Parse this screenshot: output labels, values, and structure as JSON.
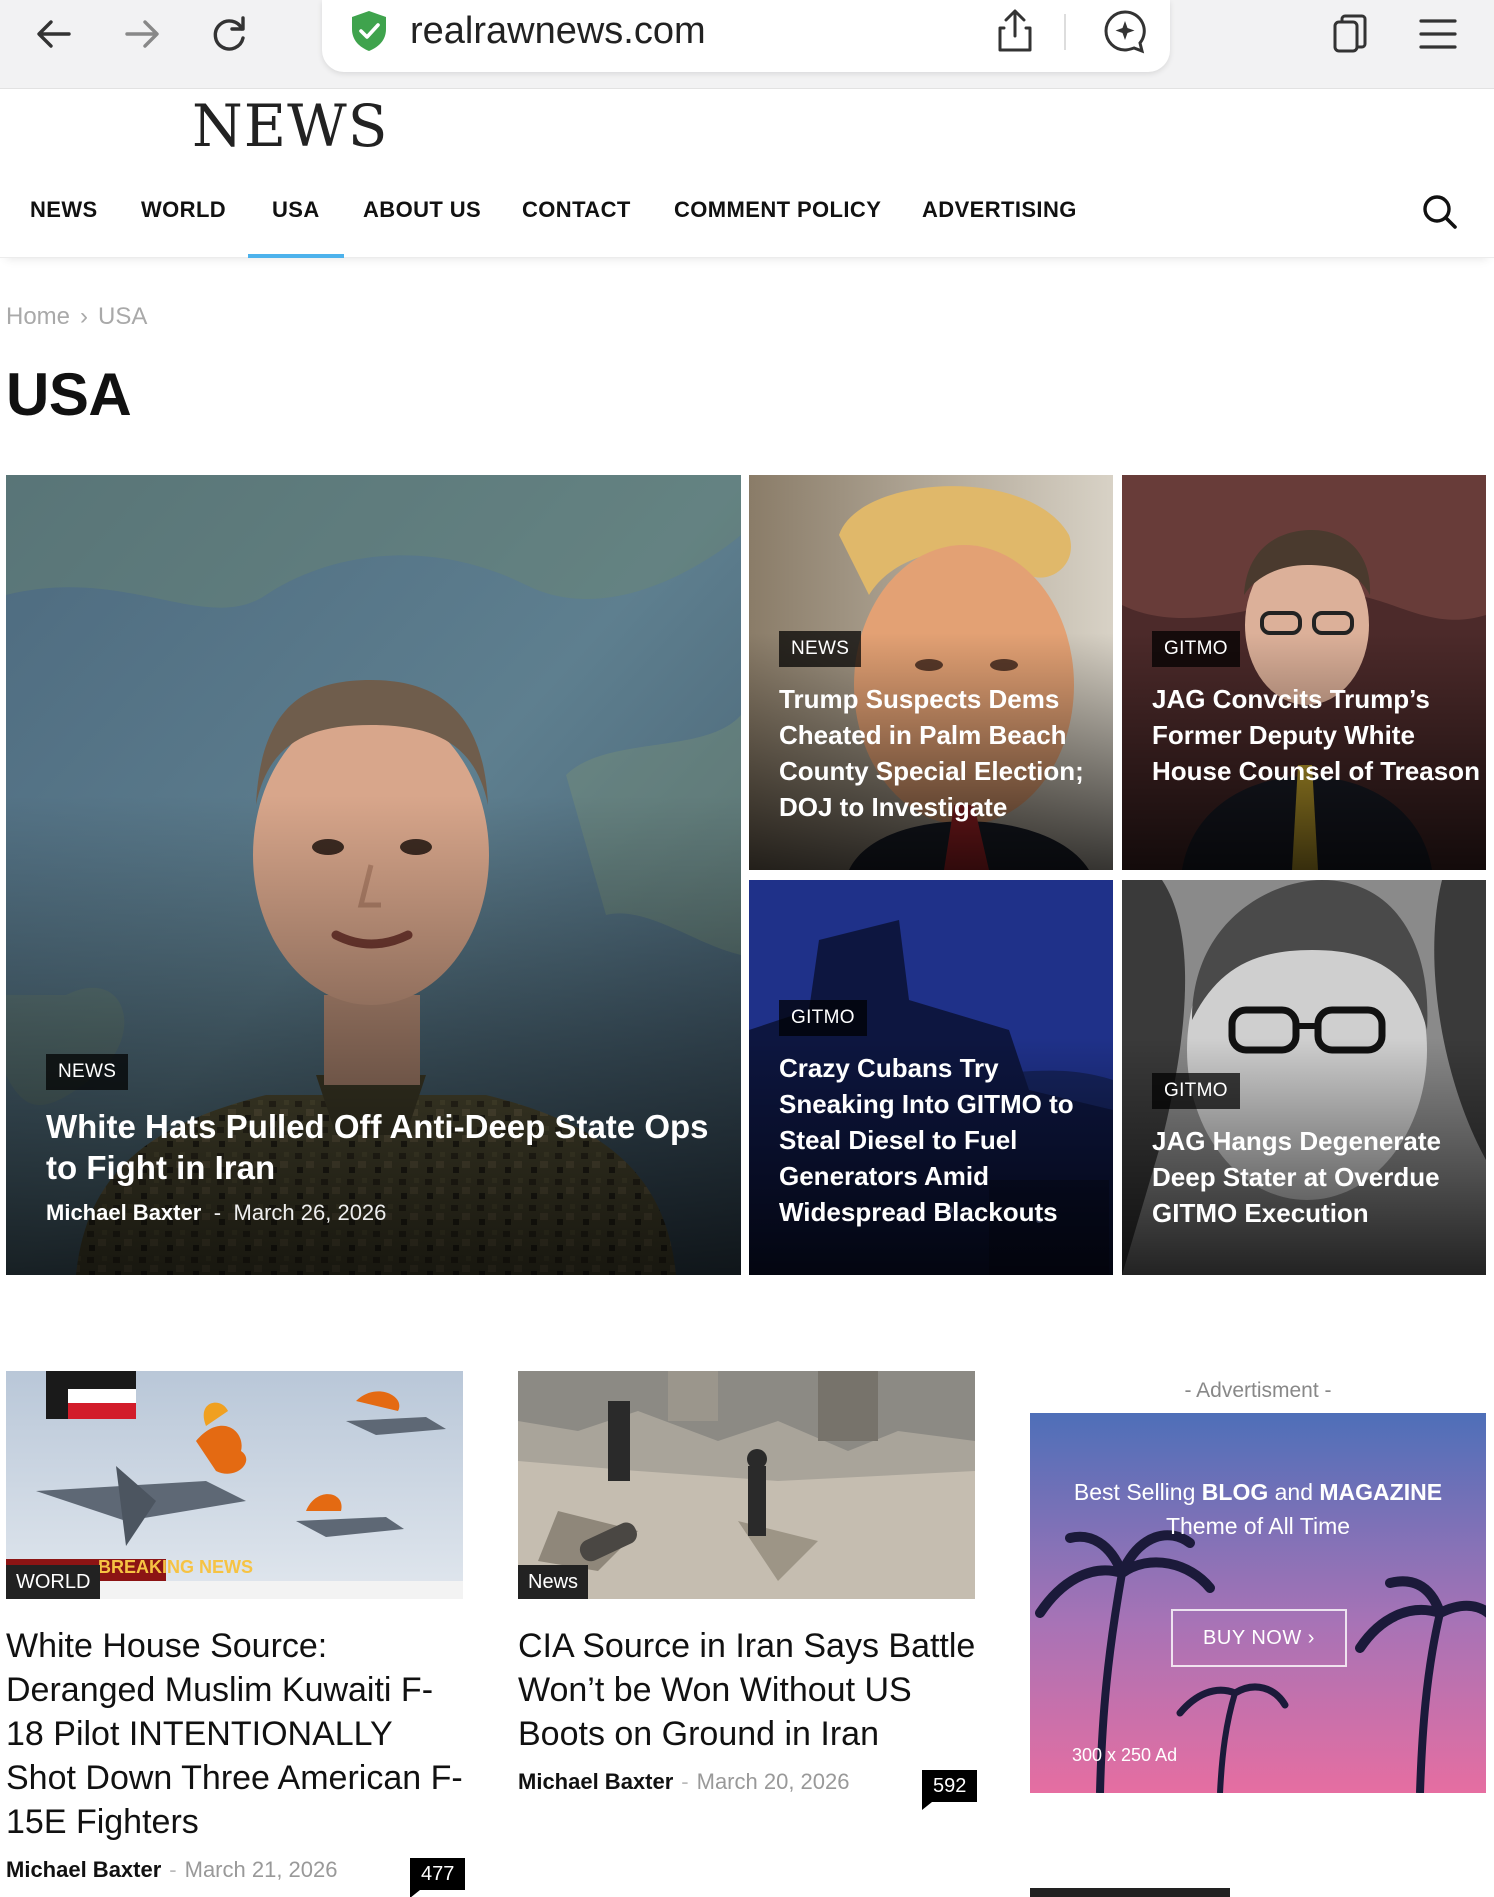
{
  "browser": {
    "url": "realrawnews.com",
    "icons": [
      "back-arrow-icon",
      "forward-arrow-icon",
      "reload-icon",
      "secure-shield-icon",
      "share-icon",
      "chat-icon",
      "tabs-icon",
      "menu-icon"
    ]
  },
  "site": {
    "logo": "NEWS"
  },
  "nav": {
    "items": [
      {
        "label": "NEWS"
      },
      {
        "label": "WORLD"
      },
      {
        "label": "USA",
        "active": true
      },
      {
        "label": "ABOUT US"
      },
      {
        "label": "CONTACT"
      },
      {
        "label": "COMMENT POLICY"
      },
      {
        "label": "ADVERTISING"
      }
    ],
    "search_icon": "search-icon"
  },
  "breadcrumb": {
    "home": "Home",
    "separator": "›",
    "current": "USA"
  },
  "page": {
    "title": "USA"
  },
  "featured": {
    "main": {
      "tag": "NEWS",
      "title": "White Hats Pulled Off Anti-Deep State Ops to Fight in Iran",
      "author": "Michael Baxter",
      "separator": "-",
      "date": "March 26, 2026"
    },
    "tiles": [
      {
        "tag": "NEWS",
        "title": "Trump Suspects Dems Cheated in Palm Beach County Special Election; DOJ to Investigate"
      },
      {
        "tag": "GITMO",
        "title": "JAG Convcits Trump’s Former Deputy White House Counsel of Treason"
      },
      {
        "tag": "GITMO",
        "title": "Crazy Cubans Try Sneaking Into GITMO to Steal Diesel to Fuel Generators Amid Widespread Blackouts"
      },
      {
        "tag": "GITMO",
        "title": "JAG Hangs Degenerate Deep Stater at Overdue GITMO Execution"
      }
    ]
  },
  "articles": [
    {
      "category": "WORLD",
      "image_overlay": "BREAKING NEWS",
      "title": "White House Source: Deranged Muslim Kuwaiti F-18 Pilot INTENTIONALLY Shot Down Three American F-15E Fighters",
      "author": "Michael Baxter",
      "separator": "-",
      "date": "March 21, 2026",
      "comments": "477"
    },
    {
      "category": "News",
      "title": "CIA Source in Iran Says Battle Won’t be Won Without US Boots on Ground in Iran",
      "author": "Michael Baxter",
      "separator": "-",
      "date": "March 20, 2026",
      "comments": "592"
    }
  ],
  "ad": {
    "label": "- Advertisment -",
    "line1_pre": "Best Selling",
    "line1_b1": "BLOG",
    "line1_mid": "and",
    "line1_b2": "MAGAZINE",
    "line2": "Theme of All Time",
    "button": "BUY NOW ›",
    "size": "300 x 250 Ad"
  },
  "colors": {
    "accent": "#4db2ec",
    "text": "#111111",
    "meta": "#999999"
  }
}
